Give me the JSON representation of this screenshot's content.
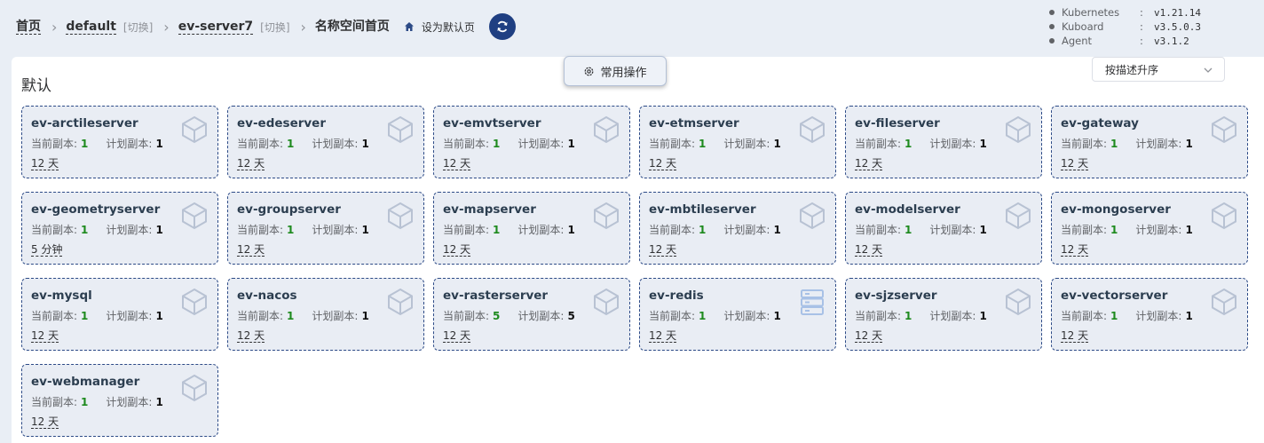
{
  "breadcrumb": {
    "home": "首页",
    "cluster": "default",
    "cluster_switch": "[切换]",
    "kuboard_server": "ev-server7",
    "server_switch": "[切换]",
    "current": "名称空间首页",
    "set_default": "设为默认页"
  },
  "versions": [
    {
      "name": "Kubernetes",
      "sep": ":",
      "value": "v1.21.14"
    },
    {
      "name": "Kuboard",
      "sep": ":",
      "value": "v3.5.0.3"
    },
    {
      "name": "Agent",
      "sep": ":",
      "value": "v3.1.2"
    }
  ],
  "toolbar": {
    "ops_label": "常用操作",
    "sort_value": "按描述升序"
  },
  "section_title": "默认",
  "labels": {
    "current_replicas": "当前副本:",
    "planned_replicas": "计划副本:"
  },
  "colors": {
    "accent": "#1f3f82",
    "card_border": "#2c4a86",
    "replica_ok": "#1e8a1e",
    "icon": "#b8c2d3"
  },
  "cards": [
    {
      "name": "ev-arctileserver",
      "current": "1",
      "planned": "1",
      "age": "12 天",
      "icon": "cube-icon"
    },
    {
      "name": "ev-edeserver",
      "current": "1",
      "planned": "1",
      "age": "12 天",
      "icon": "cube-icon"
    },
    {
      "name": "ev-emvtserver",
      "current": "1",
      "planned": "1",
      "age": "12 天",
      "icon": "cube-icon"
    },
    {
      "name": "ev-etmserver",
      "current": "1",
      "planned": "1",
      "age": "12 天",
      "icon": "cube-icon"
    },
    {
      "name": "ev-fileserver",
      "current": "1",
      "planned": "1",
      "age": "12 天",
      "icon": "cube-icon"
    },
    {
      "name": "ev-gateway",
      "current": "1",
      "planned": "1",
      "age": "12 天",
      "icon": "cube-icon"
    },
    {
      "name": "ev-geometryserver",
      "current": "1",
      "planned": "1",
      "age": "5 分钟",
      "icon": "cube-icon"
    },
    {
      "name": "ev-groupserver",
      "current": "1",
      "planned": "1",
      "age": "12 天",
      "icon": "cube-icon"
    },
    {
      "name": "ev-mapserver",
      "current": "1",
      "planned": "1",
      "age": "12 天",
      "icon": "cube-icon"
    },
    {
      "name": "ev-mbtileserver",
      "current": "1",
      "planned": "1",
      "age": "12 天",
      "icon": "cube-icon"
    },
    {
      "name": "ev-modelserver",
      "current": "1",
      "planned": "1",
      "age": "12 天",
      "icon": "cube-icon"
    },
    {
      "name": "ev-mongoserver",
      "current": "1",
      "planned": "1",
      "age": "12 天",
      "icon": "cube-icon"
    },
    {
      "name": "ev-mysql",
      "current": "1",
      "planned": "1",
      "age": "12 天",
      "icon": "cube-icon"
    },
    {
      "name": "ev-nacos",
      "current": "1",
      "planned": "1",
      "age": "12 天",
      "icon": "cube-icon"
    },
    {
      "name": "ev-rasterserver",
      "current": "5",
      "planned": "5",
      "age": "12 天",
      "icon": "cube-icon"
    },
    {
      "name": "ev-redis",
      "current": "1",
      "planned": "1",
      "age": "12 天",
      "icon": "server-icon"
    },
    {
      "name": "ev-sjzserver",
      "current": "1",
      "planned": "1",
      "age": "12 天",
      "icon": "cube-icon"
    },
    {
      "name": "ev-vectorserver",
      "current": "1",
      "planned": "1",
      "age": "12 天",
      "icon": "cube-icon"
    },
    {
      "name": "ev-webmanager",
      "current": "1",
      "planned": "1",
      "age": "12 天",
      "icon": "cube-icon"
    }
  ]
}
